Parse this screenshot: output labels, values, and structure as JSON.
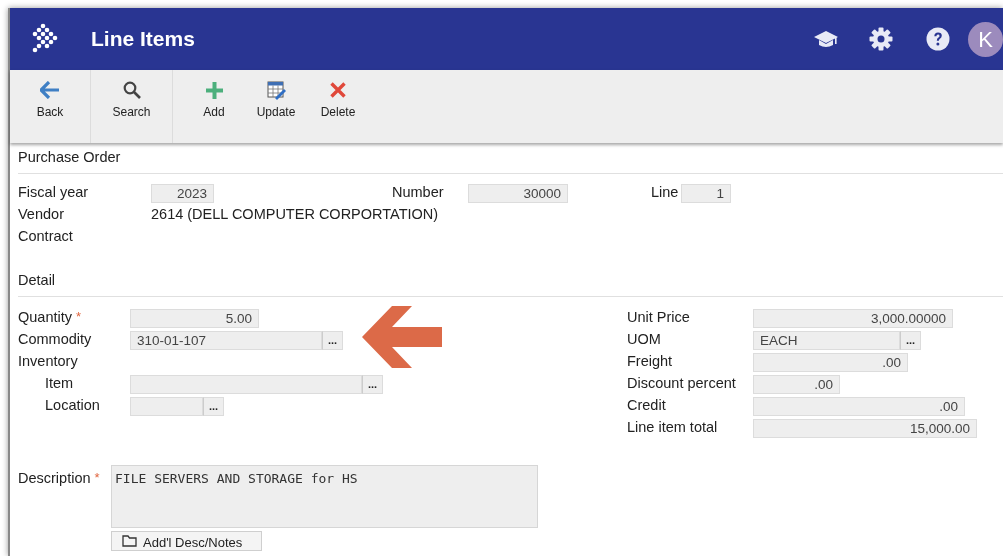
{
  "header": {
    "title": "Line Items",
    "avatar_letter": "K"
  },
  "toolbar": [
    [
      {
        "kind": "back",
        "label": "Back"
      }
    ],
    [
      {
        "kind": "search",
        "label": "Search"
      }
    ],
    [
      {
        "kind": "add",
        "label": "Add"
      },
      {
        "kind": "update",
        "label": "Update"
      },
      {
        "kind": "delete",
        "label": "Delete"
      }
    ]
  ],
  "purchase_order": {
    "title": "Purchase Order",
    "fiscal_year": {
      "label": "Fiscal year",
      "value": "2023"
    },
    "number": {
      "label": "Number",
      "value": "30000"
    },
    "line": {
      "label": "Line",
      "value": "1"
    },
    "vendor": {
      "label": "Vendor",
      "value": "2614 (DELL COMPUTER CORPORTATION)"
    },
    "contract": {
      "label": "Contract"
    }
  },
  "detail": {
    "title": "Detail",
    "left_fields": [
      {
        "label": "Quantity",
        "required_mark": "*",
        "value": "5.00"
      },
      {
        "label": "Commodity",
        "value": "310-01-107",
        "lookup_button": "..."
      },
      {
        "label": "Inventory",
        "children": [
          {
            "label": "Item",
            "lookup_button": "..."
          },
          {
            "label": "Location",
            "lookup_button": "..."
          }
        ]
      }
    ],
    "right_fields": [
      {
        "label": "Unit Price",
        "value": "3,000.00000"
      },
      {
        "label": "UOM",
        "value": "EACH",
        "lookup_button": "..."
      },
      {
        "label": "Freight",
        "value": ".00"
      },
      {
        "label": "Discount percent",
        "value": ".00"
      },
      {
        "label": "Credit",
        "value": ".00"
      },
      {
        "label": "Line item total",
        "value": "15,000.00"
      }
    ],
    "description": {
      "label": "Description",
      "required_mark": "*",
      "value": "FILE SERVERS AND STORAGE for HS"
    },
    "notes_button": "Add'l Desc/Notes"
  }
}
